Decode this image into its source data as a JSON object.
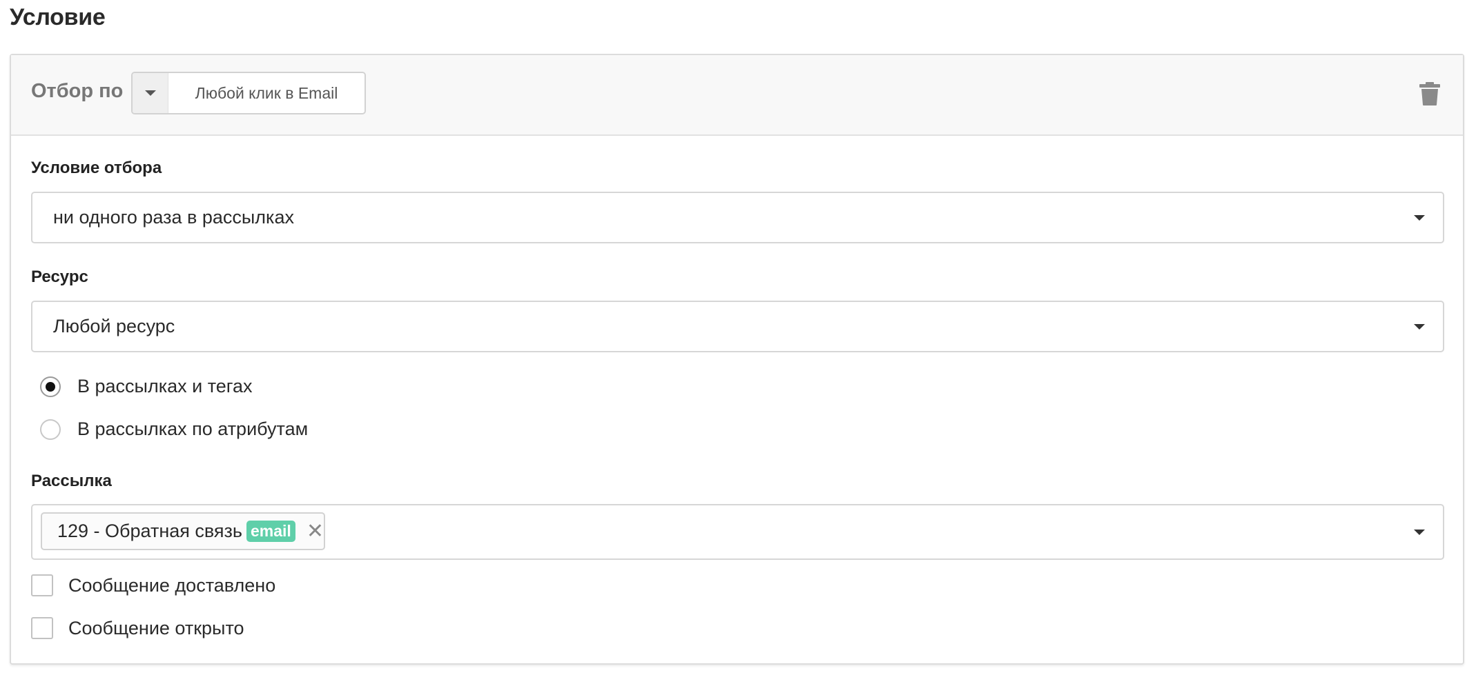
{
  "page": {
    "title": "Условие"
  },
  "filter": {
    "label": "Отбор по",
    "selected": "Любой клик в Email",
    "delete_icon": "trash-icon"
  },
  "condition": {
    "label": "Условие отбора",
    "value": "ни одного раза в рассылках"
  },
  "resource": {
    "label": "Ресурс",
    "value": "Любой ресурс"
  },
  "scope_options": [
    {
      "label": "В рассылках и тегах",
      "checked": true
    },
    {
      "label": "В рассылках по атрибутам",
      "checked": false
    }
  ],
  "mailing": {
    "label": "Рассылка",
    "tags": [
      {
        "text": "129 - Обратная связь",
        "badge": "email",
        "badge_color": "#5fcfa9"
      }
    ]
  },
  "checks": [
    {
      "label": "Сообщение доставлено",
      "checked": false
    },
    {
      "label": "Сообщение открыто",
      "checked": false
    }
  ]
}
